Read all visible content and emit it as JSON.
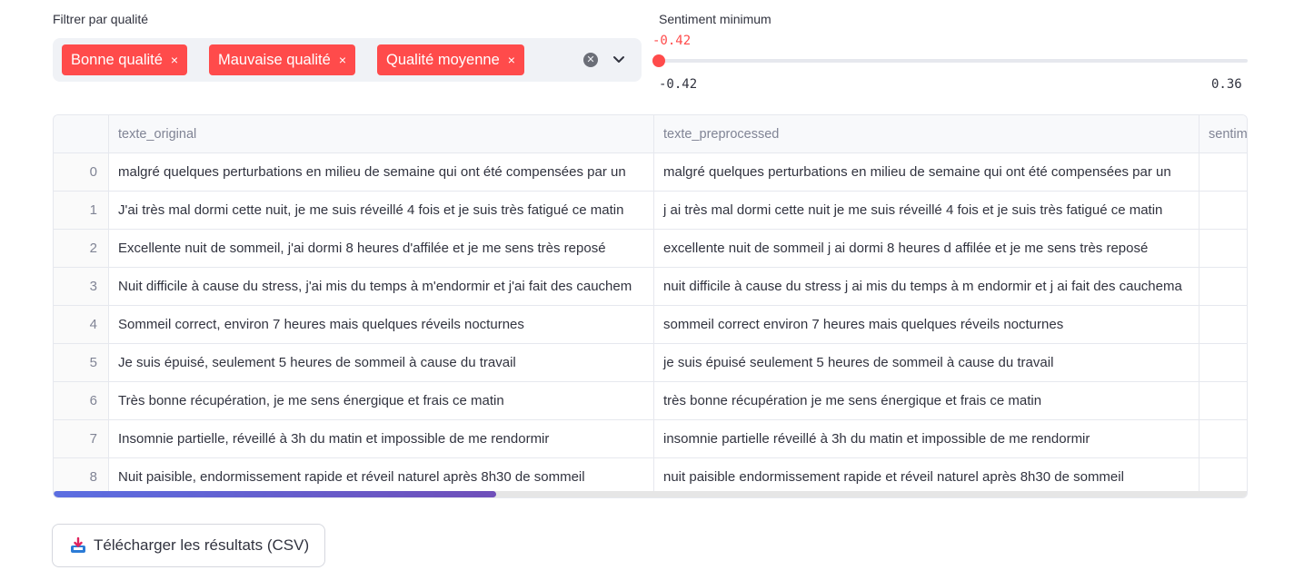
{
  "filter": {
    "label": "Filtrer par qualité",
    "tags": [
      {
        "label": "Bonne qualité",
        "remove": "×"
      },
      {
        "label": "Mauvaise qualité",
        "remove": "×"
      },
      {
        "label": "Qualité moyenne",
        "remove": "×"
      }
    ],
    "clear_icon": "clear-icon",
    "dropdown_icon": "chevron-down-icon"
  },
  "slider": {
    "label": "Sentiment minimum",
    "value": "-0.42",
    "min": "-0.42",
    "max": "0.36",
    "fraction": 0.0
  },
  "table": {
    "columns": [
      "",
      "texte_original",
      "texte_preprocessed",
      "sentim"
    ],
    "rows": [
      {
        "index": "0",
        "original": " malgré quelques perturbations en milieu de semaine qui ont été compensées par un",
        "preprocessed": "malgré quelques perturbations en milieu de semaine qui ont été compensées par un"
      },
      {
        "index": "1",
        "original": "J'ai très mal dormi cette nuit, je me suis réveillé 4 fois et je suis très fatigué ce matin",
        "preprocessed": "j ai très mal dormi cette nuit je me suis réveillé 4 fois et je suis très fatigué ce matin"
      },
      {
        "index": "2",
        "original": "Excellente nuit de sommeil, j'ai dormi 8 heures d'affilée et je me sens très reposé",
        "preprocessed": "excellente nuit de sommeil j ai dormi 8 heures d affilée et je me sens très reposé"
      },
      {
        "index": "3",
        "original": "Nuit difficile à cause du stress, j'ai mis du temps à m'endormir et j'ai fait des cauchem",
        "preprocessed": "nuit difficile à cause du stress j ai mis du temps à m endormir et j ai fait des cauchema"
      },
      {
        "index": "4",
        "original": "Sommeil correct, environ 7 heures mais quelques réveils nocturnes",
        "preprocessed": "sommeil correct environ 7 heures mais quelques réveils nocturnes"
      },
      {
        "index": "5",
        "original": "Je suis épuisé, seulement 5 heures de sommeil à cause du travail",
        "preprocessed": "je suis épuisé seulement 5 heures de sommeil à cause du travail"
      },
      {
        "index": "6",
        "original": "Très bonne récupération, je me sens énergique et frais ce matin",
        "preprocessed": "très bonne récupération je me sens énergique et frais ce matin"
      },
      {
        "index": "7",
        "original": "Insomnie partielle, réveillé à 3h du matin et impossible de me rendormir",
        "preprocessed": "insomnie partielle réveillé à 3h du matin et impossible de me rendormir"
      },
      {
        "index": "8",
        "original": "Nuit paisible, endormissement rapide et réveil naturel après 8h30 de sommeil",
        "preprocessed": "nuit paisible endormissement rapide et réveil naturel après 8h30 de sommeil"
      }
    ],
    "scroll_fraction": 0.37
  },
  "download": {
    "label": "Télécharger les résultats (CSV)",
    "icon": "inbox-tray-icon"
  },
  "colors": {
    "accent": "#ff4b4b",
    "scrollbar": "#5b6ee1"
  }
}
